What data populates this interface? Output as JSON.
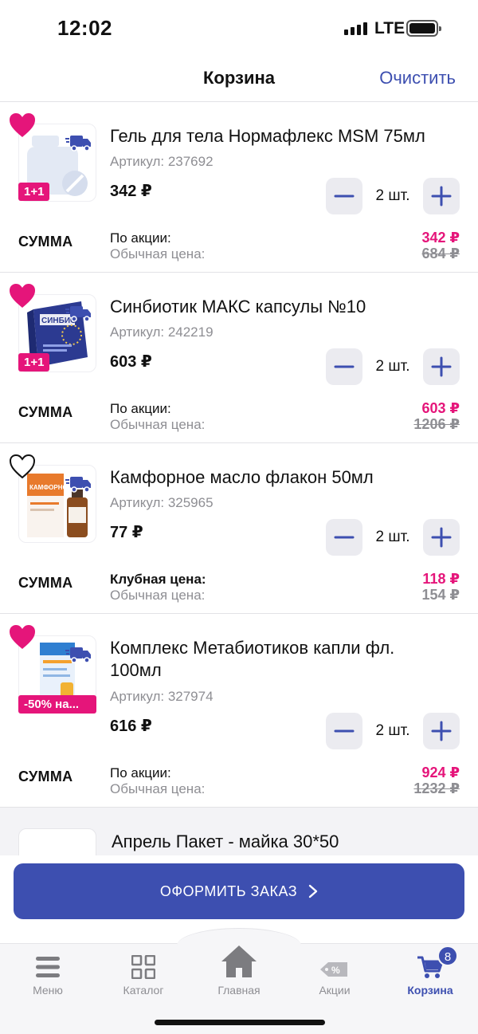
{
  "status_bar": {
    "time": "12:02",
    "network": "LTE"
  },
  "header": {
    "title": "Корзина",
    "clear_label": "Очистить"
  },
  "items": [
    {
      "name": "Гель для тела Нормафлекс MSM 75мл",
      "sku": "Артикул: 237692",
      "price": "342 ₽",
      "quantity": "2 шт.",
      "favorite": true,
      "badge": "1+1",
      "sum_label": "СУММА",
      "promo_label": "По акции:",
      "regular_label": "Обычная цена:",
      "promo_value": "342 ₽",
      "regular_value": "684 ₽"
    },
    {
      "name": "Синбиотик МАКС капсулы №10",
      "sku": "Артикул: 242219",
      "price": "603 ₽",
      "quantity": "2 шт.",
      "favorite": true,
      "badge": "1+1",
      "sum_label": "СУММА",
      "promo_label": "По акции:",
      "regular_label": "Обычная цена:",
      "promo_value": "603 ₽",
      "regular_value": "1206 ₽"
    },
    {
      "name": "Камфорное масло флакон 50мл",
      "sku": "Артикул: 325965",
      "price": "77 ₽",
      "quantity": "2 шт.",
      "favorite": false,
      "badge": "",
      "sum_label": "СУММА",
      "promo_label": "Клубная цена:",
      "regular_label": "Обычная цена:",
      "promo_value": "118 ₽",
      "regular_value": "154 ₽"
    },
    {
      "name": "Комплекс Метабиотиков капли фл. 100мл",
      "sku": "Артикул: 327974",
      "price": "616 ₽",
      "quantity": "2 шт.",
      "favorite": true,
      "badge": "-50% на...",
      "sum_label": "СУММА",
      "promo_label": "По акции:",
      "regular_label": "Обычная цена:",
      "promo_value": "924 ₽",
      "regular_value": "1232 ₽"
    }
  ],
  "partial_item": {
    "name": "Апрель Пакет - майка 30*50"
  },
  "checkout": {
    "label": "ОФОРМИТЬ ЗАКАЗ"
  },
  "tabbar": {
    "tabs": [
      {
        "label": "Меню",
        "icon": "menu-icon"
      },
      {
        "label": "Каталог",
        "icon": "grid-icon"
      },
      {
        "label": "Главная",
        "icon": "home-icon"
      },
      {
        "label": "Акции",
        "icon": "tag-icon"
      },
      {
        "label": "Корзина",
        "icon": "cart-icon",
        "active": true
      }
    ],
    "cart_count": "8"
  },
  "colors": {
    "accent": "#3d4fb0",
    "promo": "#e5157a",
    "muted": "#8e8e93"
  }
}
